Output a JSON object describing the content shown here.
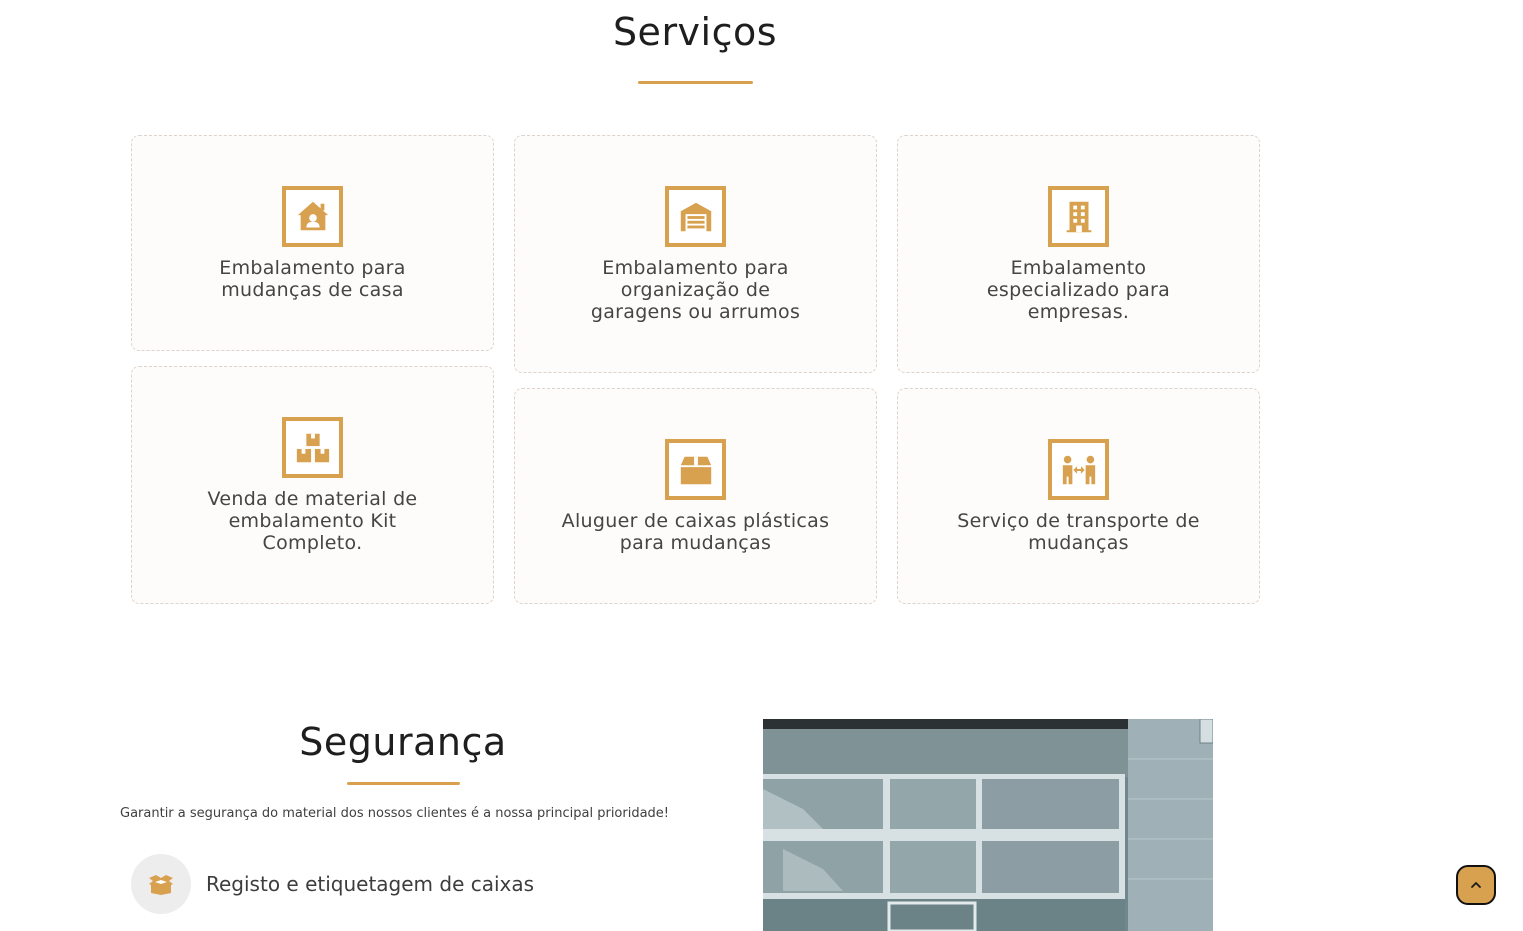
{
  "services": {
    "title": "Serviços",
    "cards": [
      {
        "label": "Embalamento para mudanças de casa",
        "icon": "house-user-icon"
      },
      {
        "label": "Embalamento para organização de garagens ou arrumos",
        "icon": "warehouse-icon"
      },
      {
        "label": "Embalamento especializado para empresas.",
        "icon": "building-icon"
      },
      {
        "label": "Venda de material de embalamento Kit Completo.",
        "icon": "boxes-icon"
      },
      {
        "label": "Aluguer de caixas plásticas para mudanças",
        "icon": "box-icon"
      },
      {
        "label": "Serviço de transporte de mudanças",
        "icon": "people-arrows-icon"
      }
    ]
  },
  "security": {
    "title": "Segurança",
    "subtitle": "Garantir a segurança do material dos nossos clientes é a nossa principal prioridade!",
    "features": [
      {
        "label": "Registo e etiquetagem de caixas",
        "icon": "box-open-icon"
      }
    ]
  },
  "colors": {
    "accent": "#d8a14f",
    "card_bg": "#fdfcfb",
    "text": "#454545"
  }
}
